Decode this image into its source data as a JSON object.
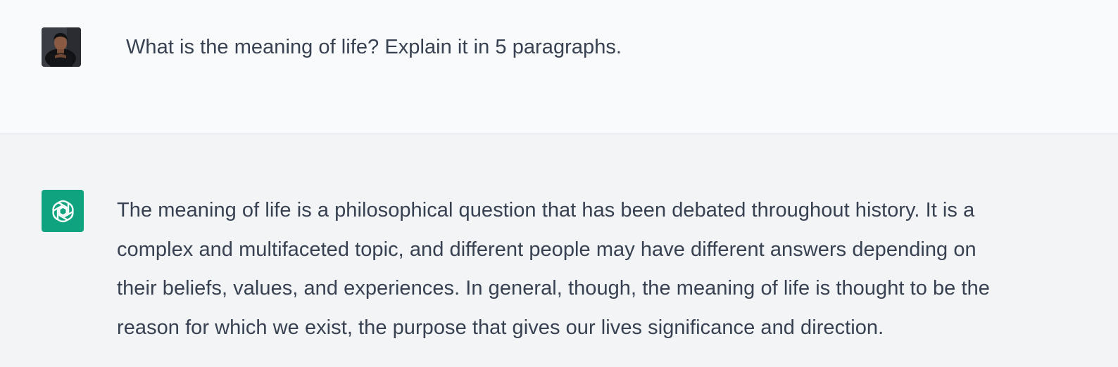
{
  "conversation": {
    "user_message": {
      "avatar_icon": "user-photo-avatar",
      "text": "What is the meaning of life? Explain it in 5 paragraphs."
    },
    "assistant_message": {
      "avatar_icon": "openai-logo-icon",
      "avatar_color": "#10a37f",
      "lines": [
        "The meaning of life is a philosophical question that has been debated throughout history. It is a",
        "complex and multifaceted topic, and different people may have different answers depending on",
        "their beliefs, values, and experiences. In general, though, the meaning of life is thought to be the",
        "reason for which we exist, the purpose that gives our lives significance and direction."
      ]
    }
  },
  "colors": {
    "user_row_bg": "#f9fafb",
    "assistant_row_bg": "#f3f4f6",
    "text": "#374151",
    "divider": "#d9d9e3"
  }
}
